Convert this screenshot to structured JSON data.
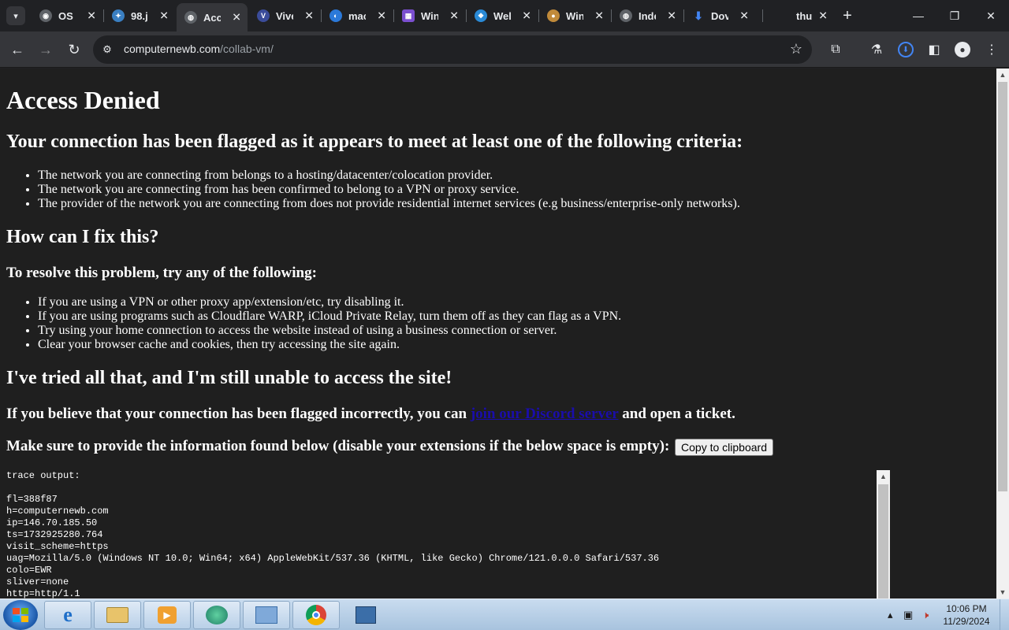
{
  "tabs": [
    {
      "title": "OS",
      "favicon": "globe-icon",
      "color": "#9aa0a6"
    },
    {
      "title": "98.j",
      "favicon": "page-icon",
      "color": "#4a90d9"
    },
    {
      "title": "Acc",
      "favicon": "computernewb-icon",
      "color": "#9aa0a6",
      "active": true
    },
    {
      "title": "Vive",
      "favicon": "v9-icon",
      "color": "#3b4c9a"
    },
    {
      "title": "mac",
      "favicon": "mac-icon",
      "color": "#2b79d9"
    },
    {
      "title": "Win",
      "favicon": "win-icon",
      "color": "#7b4fd0"
    },
    {
      "title": "Wel",
      "favicon": "win-logo-icon",
      "color": "#2a8ad6"
    },
    {
      "title": "Win",
      "favicon": "winxp-icon",
      "color": "#c08a3a"
    },
    {
      "title": "Inde",
      "favicon": "server-icon",
      "color": "#9aa0a6"
    },
    {
      "title": "Dov",
      "favicon": "download-icon",
      "color": "#4285f4"
    },
    {
      "title": "thu",
      "favicon": "",
      "color": "#202124"
    }
  ],
  "url": {
    "host": "computernewb.com",
    "path": "/collab-vm/"
  },
  "content": {
    "h1": "Access Denied",
    "flagged_heading": "Your connection has been flagged as it appears to meet at least one of the following criteria:",
    "criteria": [
      "The network you are connecting from belongs to a hosting/datacenter/colocation provider.",
      "The network you are connecting from has been confirmed to belong to a VPN or proxy service.",
      "The provider of the network you are connecting from does not provide residential internet services (e.g business/enterprise-only networks)."
    ],
    "fix_heading": "How can I fix this?",
    "resolve_heading": "To resolve this problem, try any of the following:",
    "fixes": [
      "If you are using a VPN or other proxy app/extension/etc, try disabling it.",
      "If you are using programs such as Cloudflare WARP, iCloud Private Relay, turn them off as they can flag as a VPN.",
      "Try using your home connection to access the website instead of using a business connection or server.",
      "Clear your browser cache and cookies, then try accessing the site again."
    ],
    "still_heading": "I've tried all that, and I'm still unable to access the site!",
    "incorrect_pre": "If you believe that your connection has been flagged incorrectly, you can",
    "incorrect_link": "join our Discord server",
    "incorrect_post": "and open a ticket.",
    "provide_text": "Make sure to provide the information found below (disable your extensions if the below space is empty):",
    "copy_button": "Copy to clipboard",
    "trace_lines": [
      "trace output:",
      "",
      "fl=388f87",
      "h=computernewb.com",
      "ip=146.70.185.50",
      "ts=1732925280.764",
      "visit_scheme=https",
      "uag=Mozilla/5.0 (Windows NT 10.0; Win64; x64) AppleWebKit/537.36 (KHTML, like Gecko) Chrome/121.0.0.0 Safari/537.36",
      "colo=EWR",
      "sliver=none",
      "http=http/1.1"
    ]
  },
  "clock": {
    "time": "10:06 PM",
    "date": "11/29/2024"
  }
}
